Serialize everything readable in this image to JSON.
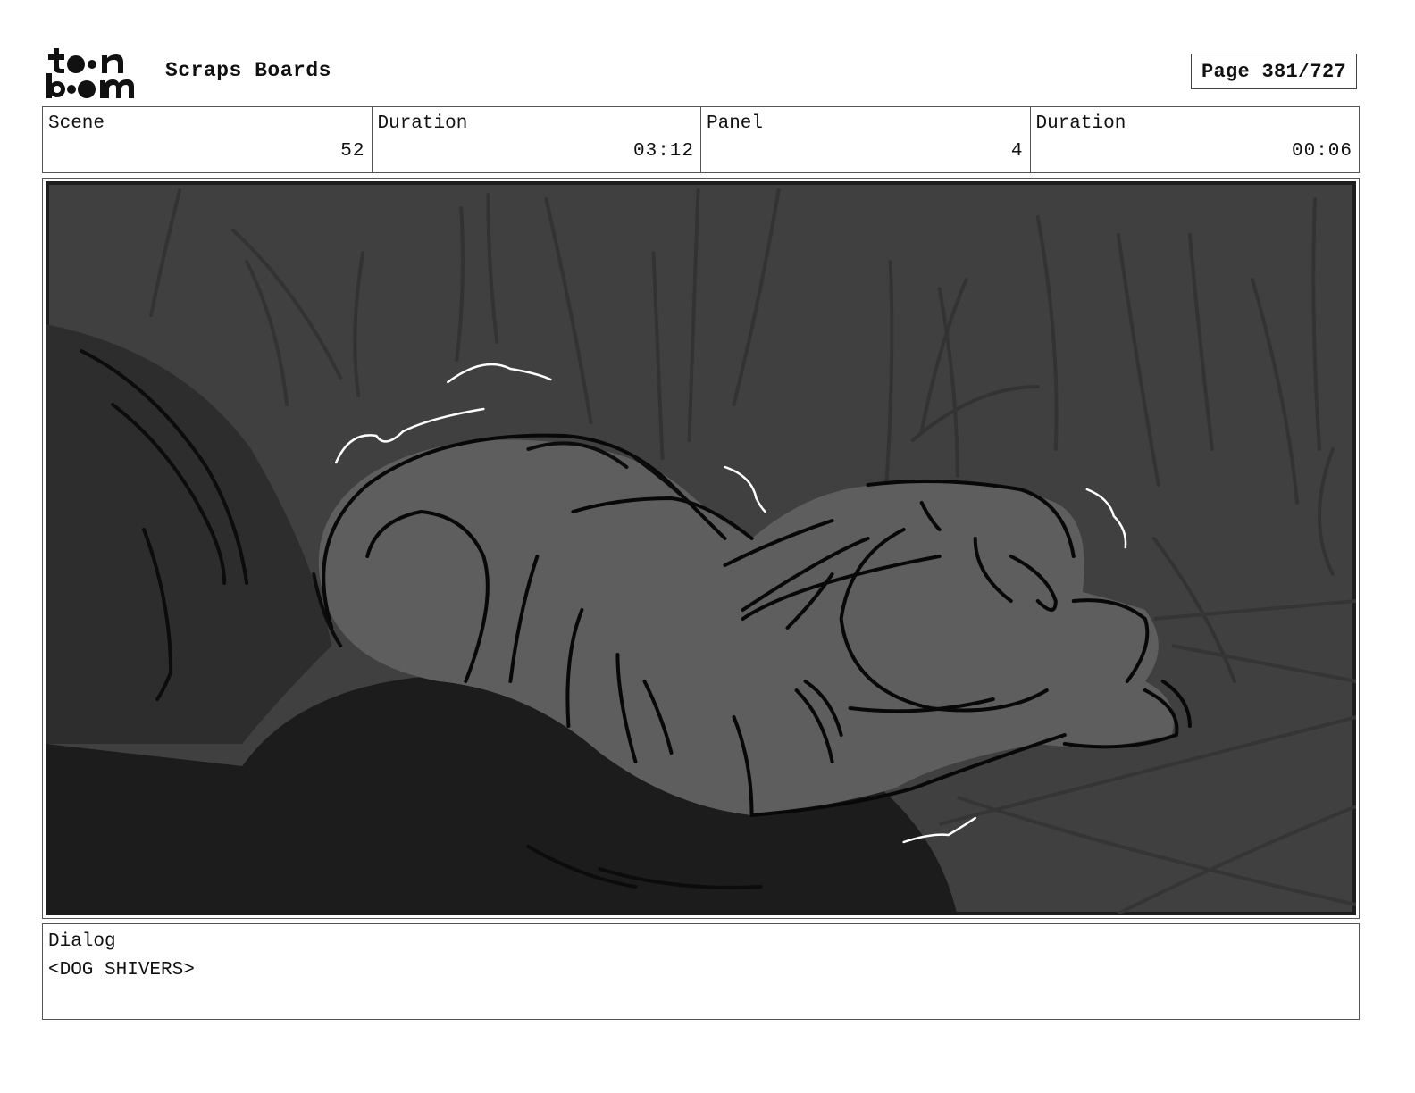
{
  "brand": {
    "logo_text": "toon boom",
    "logo_icon": "toon-boom-logo"
  },
  "header": {
    "project_title": "Scraps Boards",
    "page_label": "Page 381/727"
  },
  "info": {
    "scene_label": "Scene",
    "scene_value": "52",
    "scene_duration_label": "Duration",
    "scene_duration_value": "03:12",
    "panel_label": "Panel",
    "panel_value": "4",
    "panel_duration_label": "Duration",
    "panel_duration_value": "00:06"
  },
  "panel": {
    "image_icon": "storyboard-sketch-sleeping-dog-shivering"
  },
  "dialog": {
    "label": "Dialog",
    "text": "<DOG SHIVERS>"
  }
}
